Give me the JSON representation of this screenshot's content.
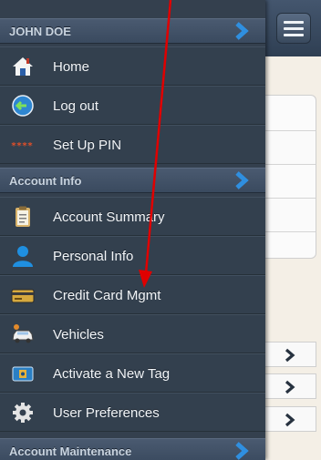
{
  "drawer": {
    "user_header": "JOHN DOE",
    "items_top": [
      {
        "label": "Home",
        "icon": "home-icon"
      },
      {
        "label": "Log out",
        "icon": "logout-icon"
      },
      {
        "label": "Set Up PIN",
        "icon": "pin-icon"
      }
    ],
    "section_account_info": "Account Info",
    "items_account": [
      {
        "label": "Account Summary",
        "icon": "clipboard-icon"
      },
      {
        "label": "Personal Info",
        "icon": "person-icon"
      },
      {
        "label": "Credit Card Mgmt",
        "icon": "credit-card-icon"
      },
      {
        "label": "Vehicles",
        "icon": "vehicles-icon"
      },
      {
        "label": "Activate a New Tag",
        "icon": "tag-icon"
      },
      {
        "label": "User Preferences",
        "icon": "gear-icon"
      }
    ],
    "section_account_maintenance": "Account Maintenance"
  },
  "colors": {
    "drawer_bg": "#34404e",
    "section_bg": "#44546a",
    "chevron_blue": "#2f8fe0",
    "annotation_red": "#e00000"
  }
}
